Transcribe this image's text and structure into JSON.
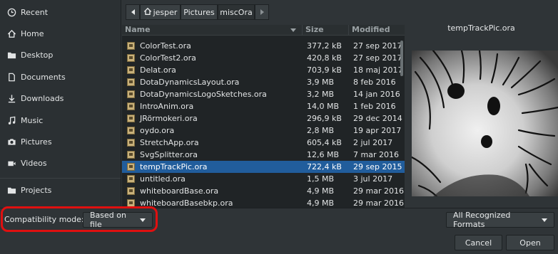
{
  "sidebar": {
    "items": [
      {
        "label": "Recent",
        "icon": "clock-icon"
      },
      {
        "label": "Home",
        "icon": "home-icon"
      },
      {
        "label": "Desktop",
        "icon": "folder-icon"
      },
      {
        "label": "Documents",
        "icon": "document-icon"
      },
      {
        "label": "Downloads",
        "icon": "download-icon"
      },
      {
        "label": "Music",
        "icon": "music-icon"
      },
      {
        "label": "Pictures",
        "icon": "camera-icon"
      },
      {
        "label": "Videos",
        "icon": "video-icon"
      },
      {
        "label": "Projects",
        "icon": "folder-icon"
      }
    ]
  },
  "pathbar": {
    "crumbs": [
      "jesper",
      "Pictures",
      "miscOra"
    ]
  },
  "list": {
    "headers": {
      "name": "Name",
      "size": "Size",
      "modified": "Modified"
    },
    "rows": [
      {
        "name": "ColorTest.ora",
        "size": "377,2 kB",
        "date": "27 sep 2017"
      },
      {
        "name": "ColorTest2.ora",
        "size": "420,8 kB",
        "date": "27 sep 2017"
      },
      {
        "name": "Delat.ora",
        "size": "703,9 kB",
        "date": "18 maj 2017"
      },
      {
        "name": "DotaDynamicsLayout.ora",
        "size": "3,9 MB",
        "date": "8 feb 2016"
      },
      {
        "name": "DotaDynamicsLogoSketches.ora",
        "size": "3,2 MB",
        "date": "14 jan 2016"
      },
      {
        "name": "IntroAnim.ora",
        "size": "14,0 MB",
        "date": "1 feb 2016"
      },
      {
        "name": "JRörmokeri.ora",
        "size": "296,9 kB",
        "date": "29 dec 2014"
      },
      {
        "name": "oydo.ora",
        "size": "2,8 MB",
        "date": "19 apr 2017"
      },
      {
        "name": "StretchApp.ora",
        "size": "605,4 kB",
        "date": "2 jul 2017"
      },
      {
        "name": "SvgSplitter.ora",
        "size": "12,6 MB",
        "date": "7 mar 2016"
      },
      {
        "name": "tempTrackPic.ora",
        "size": "722,4 kB",
        "date": "29 sep 2015"
      },
      {
        "name": "untitled.ora",
        "size": "1,5 MB",
        "date": "3 jul 2017"
      },
      {
        "name": "whiteboardBase.ora",
        "size": "4,9 MB",
        "date": "29 mar 2016"
      },
      {
        "name": "whiteboardBasebkp.ora",
        "size": "4,9 MB",
        "date": "29 mar 2016"
      }
    ],
    "selected_index": 10
  },
  "preview": {
    "title": "tempTrackPic.ora"
  },
  "bottom": {
    "compat_label": "Compatibility mode:",
    "compat_value": "Based on file",
    "filter_value": "All Recognized Formats",
    "cancel": "Cancel",
    "open": "Open"
  },
  "colors": {
    "selection": "#215d9c",
    "highlight_ring": "#e01010"
  }
}
